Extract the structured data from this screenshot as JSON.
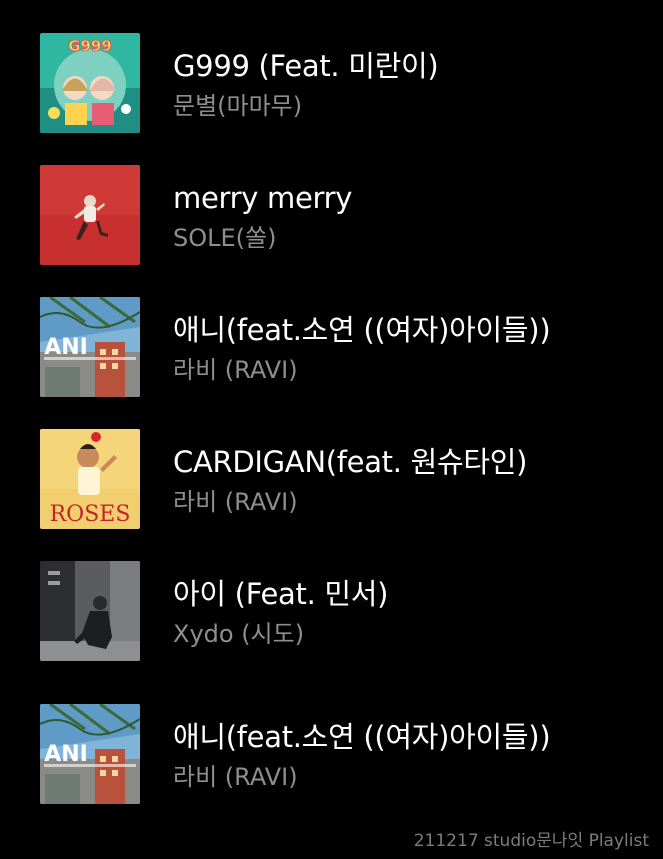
{
  "tracks": [
    {
      "title": "G999 (Feat. 미란이)",
      "artist": "문별(마마무)",
      "art_text": "G999",
      "art_icon": "album-art-g999"
    },
    {
      "title": "merry merry",
      "artist": "SOLE(쏠)",
      "art_icon": "album-art-merry-merry"
    },
    {
      "title": "애니(feat.소연 ((여자)아이들))",
      "artist": "라비 (RAVI)",
      "art_text": "ANI",
      "art_icon": "album-art-ani"
    },
    {
      "title": "CARDIGAN(feat. 원슈타인)",
      "artist": "라비 (RAVI)",
      "art_text": "ROSES",
      "art_icon": "album-art-roses"
    },
    {
      "title": "아이 (Feat. 민서)",
      "artist": "Xydo (시도)",
      "art_icon": "album-art-ai"
    },
    {
      "title": "애니(feat.소연 ((여자)아이들))",
      "artist": "라비 (RAVI)",
      "art_text": "ANI",
      "art_icon": "album-art-ani"
    }
  ],
  "footer": "211217 studio문나잇 Playlist",
  "colors": {
    "background": "#000000",
    "title": "#ffffff",
    "artist": "#8e8e8e"
  }
}
